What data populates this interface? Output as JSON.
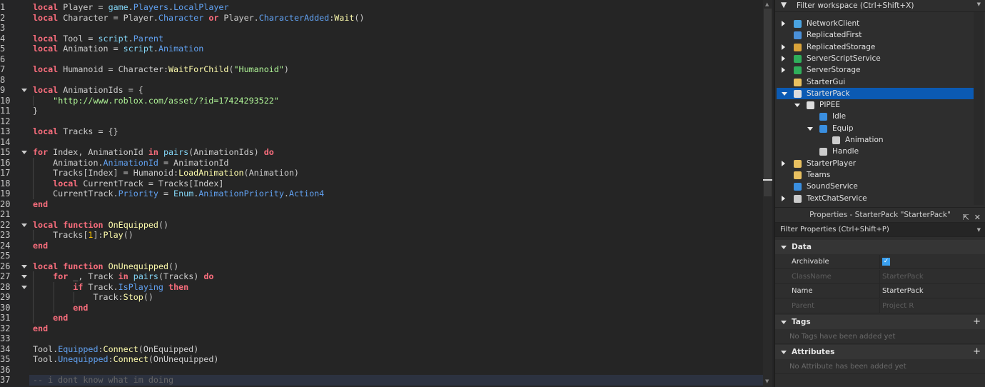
{
  "editor": {
    "lines": [
      [
        [
          "kw",
          "local"
        ],
        [
          "txt",
          " Player = "
        ],
        [
          "bi",
          "game"
        ],
        [
          "txt",
          "."
        ],
        [
          "prop",
          "Players"
        ],
        [
          "txt",
          "."
        ],
        [
          "prop",
          "LocalPlayer"
        ]
      ],
      [
        [
          "kw",
          "local"
        ],
        [
          "txt",
          " Character = Player."
        ],
        [
          "prop",
          "Character"
        ],
        [
          "txt",
          " "
        ],
        [
          "kw",
          "or"
        ],
        [
          "txt",
          " Player."
        ],
        [
          "prop",
          "CharacterAdded"
        ],
        [
          "txt",
          ":"
        ],
        [
          "fn",
          "Wait"
        ],
        [
          "txt",
          "()"
        ]
      ],
      [],
      [
        [
          "kw",
          "local"
        ],
        [
          "txt",
          " Tool = "
        ],
        [
          "bi",
          "script"
        ],
        [
          "txt",
          "."
        ],
        [
          "prop",
          "Parent"
        ]
      ],
      [
        [
          "kw",
          "local"
        ],
        [
          "txt",
          " Animation = "
        ],
        [
          "bi",
          "script"
        ],
        [
          "txt",
          "."
        ],
        [
          "prop",
          "Animation"
        ]
      ],
      [],
      [
        [
          "kw",
          "local"
        ],
        [
          "txt",
          " Humanoid = Character:"
        ],
        [
          "fn",
          "WaitForChild"
        ],
        [
          "txt",
          "("
        ],
        [
          "str",
          "\"Humanoid\""
        ],
        [
          "txt",
          ")"
        ]
      ],
      [],
      [
        [
          "kw",
          "local"
        ],
        [
          "txt",
          " AnimationIds = {"
        ]
      ],
      [
        [
          "txt",
          "    "
        ],
        [
          "str",
          "\"http://www.roblox.com/asset/?id=17424293522\""
        ]
      ],
      [
        [
          "txt",
          "}"
        ]
      ],
      [],
      [
        [
          "kw",
          "local"
        ],
        [
          "txt",
          " Tracks = {}"
        ]
      ],
      [],
      [
        [
          "kw",
          "for"
        ],
        [
          "txt",
          " Index, AnimationId "
        ],
        [
          "kw",
          "in"
        ],
        [
          "txt",
          " "
        ],
        [
          "bi",
          "pairs"
        ],
        [
          "txt",
          "(AnimationIds) "
        ],
        [
          "kw",
          "do"
        ]
      ],
      [
        [
          "txt",
          "    Animation."
        ],
        [
          "prop",
          "AnimationId"
        ],
        [
          "txt",
          " = AnimationId"
        ]
      ],
      [
        [
          "txt",
          "    Tracks[Index] = Humanoid:"
        ],
        [
          "fn",
          "LoadAnimation"
        ],
        [
          "txt",
          "(Animation)"
        ]
      ],
      [
        [
          "txt",
          "    "
        ],
        [
          "kw",
          "local"
        ],
        [
          "txt",
          " CurrentTrack = Tracks[Index]"
        ]
      ],
      [
        [
          "txt",
          "    CurrentTrack."
        ],
        [
          "prop",
          "Priority"
        ],
        [
          "txt",
          " = "
        ],
        [
          "bi",
          "Enum"
        ],
        [
          "txt",
          "."
        ],
        [
          "prop",
          "AnimationPriority"
        ],
        [
          "txt",
          "."
        ],
        [
          "prop",
          "Action4"
        ]
      ],
      [
        [
          "kw",
          "end"
        ]
      ],
      [],
      [
        [
          "kw",
          "local"
        ],
        [
          "txt",
          " "
        ],
        [
          "kw",
          "function"
        ],
        [
          "txt",
          " "
        ],
        [
          "fn",
          "OnEquipped"
        ],
        [
          "txt",
          "()"
        ]
      ],
      [
        [
          "txt",
          "    Tracks["
        ],
        [
          "num",
          "1"
        ],
        [
          "txt",
          "]:"
        ],
        [
          "fn",
          "Play"
        ],
        [
          "txt",
          "()"
        ]
      ],
      [
        [
          "kw",
          "end"
        ]
      ],
      [],
      [
        [
          "kw",
          "local"
        ],
        [
          "txt",
          " "
        ],
        [
          "kw",
          "function"
        ],
        [
          "txt",
          " "
        ],
        [
          "fn",
          "OnUnequipped"
        ],
        [
          "txt",
          "()"
        ]
      ],
      [
        [
          "txt",
          "    "
        ],
        [
          "kw",
          "for"
        ],
        [
          "txt",
          " _, Track "
        ],
        [
          "kw",
          "in"
        ],
        [
          "txt",
          " "
        ],
        [
          "bi",
          "pairs"
        ],
        [
          "txt",
          "(Tracks) "
        ],
        [
          "kw",
          "do"
        ]
      ],
      [
        [
          "txt",
          "        "
        ],
        [
          "kw",
          "if"
        ],
        [
          "txt",
          " Track."
        ],
        [
          "prop",
          "IsPlaying"
        ],
        [
          "txt",
          " "
        ],
        [
          "kw",
          "then"
        ]
      ],
      [
        [
          "txt",
          "            Track:"
        ],
        [
          "fn",
          "Stop"
        ],
        [
          "txt",
          "()"
        ]
      ],
      [
        [
          "txt",
          "        "
        ],
        [
          "kw",
          "end"
        ]
      ],
      [
        [
          "txt",
          "    "
        ],
        [
          "kw",
          "end"
        ]
      ],
      [
        [
          "kw",
          "end"
        ]
      ],
      [],
      [
        [
          "txt",
          "Tool."
        ],
        [
          "prop",
          "Equipped"
        ],
        [
          "txt",
          ":"
        ],
        [
          "fn",
          "Connect"
        ],
        [
          "txt",
          "(OnEquipped)"
        ]
      ],
      [
        [
          "txt",
          "Tool."
        ],
        [
          "prop",
          "Unequipped"
        ],
        [
          "txt",
          ":"
        ],
        [
          "fn",
          "Connect"
        ],
        [
          "txt",
          "(OnUnequipped)"
        ]
      ],
      [],
      [
        [
          "cm",
          "-- i dont know what im doing"
        ]
      ]
    ],
    "fold_lines": [
      9,
      15,
      22,
      26,
      27,
      28
    ],
    "current_line": 37
  },
  "explorer": {
    "filter_placeholder": "Filter workspace (Ctrl+Shift+X)",
    "items": [
      {
        "label": "NetworkClient",
        "depth": 0,
        "expander": "collapsed",
        "icon": "network-client-icon",
        "color": "#4aa3e0"
      },
      {
        "label": "ReplicatedFirst",
        "depth": 0,
        "expander": "none",
        "icon": "replicated-first-icon",
        "color": "#4a90d9"
      },
      {
        "label": "ReplicatedStorage",
        "depth": 0,
        "expander": "collapsed",
        "icon": "replicated-storage-icon",
        "color": "#d9a33a"
      },
      {
        "label": "ServerScriptService",
        "depth": 0,
        "expander": "collapsed",
        "icon": "server-script-service-icon",
        "color": "#2fae5a"
      },
      {
        "label": "ServerStorage",
        "depth": 0,
        "expander": "collapsed",
        "icon": "server-storage-icon",
        "color": "#2fae5a"
      },
      {
        "label": "StarterGui",
        "depth": 0,
        "expander": "none",
        "icon": "starter-gui-icon",
        "color": "#e8c060"
      },
      {
        "label": "StarterPack",
        "depth": 0,
        "expander": "expanded",
        "icon": "starter-pack-icon",
        "color": "#dddddd",
        "selected": true
      },
      {
        "label": "PIPEE",
        "depth": 1,
        "expander": "expanded",
        "icon": "tool-icon",
        "color": "#dddddd"
      },
      {
        "label": "Idle",
        "depth": 2,
        "expander": "none",
        "icon": "local-script-icon",
        "color": "#3a8fe0"
      },
      {
        "label": "Equip",
        "depth": 2,
        "expander": "expanded",
        "icon": "local-script-icon",
        "color": "#3a8fe0"
      },
      {
        "label": "Animation",
        "depth": 3,
        "expander": "none",
        "icon": "animation-icon",
        "color": "#cccccc"
      },
      {
        "label": "Handle",
        "depth": 2,
        "expander": "none",
        "icon": "part-icon",
        "color": "#cccccc"
      },
      {
        "label": "StarterPlayer",
        "depth": 0,
        "expander": "collapsed",
        "icon": "starter-player-icon",
        "color": "#e8c060"
      },
      {
        "label": "Teams",
        "depth": 0,
        "expander": "none",
        "icon": "teams-icon",
        "color": "#e8c060"
      },
      {
        "label": "SoundService",
        "depth": 0,
        "expander": "none",
        "icon": "sound-service-icon",
        "color": "#3a8fe0"
      },
      {
        "label": "TextChatService",
        "depth": 0,
        "expander": "collapsed",
        "icon": "text-chat-service-icon",
        "color": "#cccccc"
      }
    ]
  },
  "properties": {
    "title": "Properties - StarterPack \"StarterPack\"",
    "filter_placeholder": "Filter Properties (Ctrl+Shift+P)",
    "data_section": "Data",
    "rows": [
      {
        "key": "Archivable",
        "value": "",
        "checked": true,
        "enabled": true
      },
      {
        "key": "ClassName",
        "value": "StarterPack",
        "enabled": false
      },
      {
        "key": "Name",
        "value": "StarterPack",
        "enabled": true
      },
      {
        "key": "Parent",
        "value": "Project R",
        "enabled": false
      }
    ],
    "tags_section": "Tags",
    "tags_empty": "No Tags have been added yet",
    "attributes_section": "Attributes",
    "attributes_empty": "No Attribute has been added yet"
  },
  "colors": {
    "selection": "#0b5ab3",
    "keyword": "#f86d7c",
    "property": "#61a1f1",
    "string": "#adf195"
  }
}
